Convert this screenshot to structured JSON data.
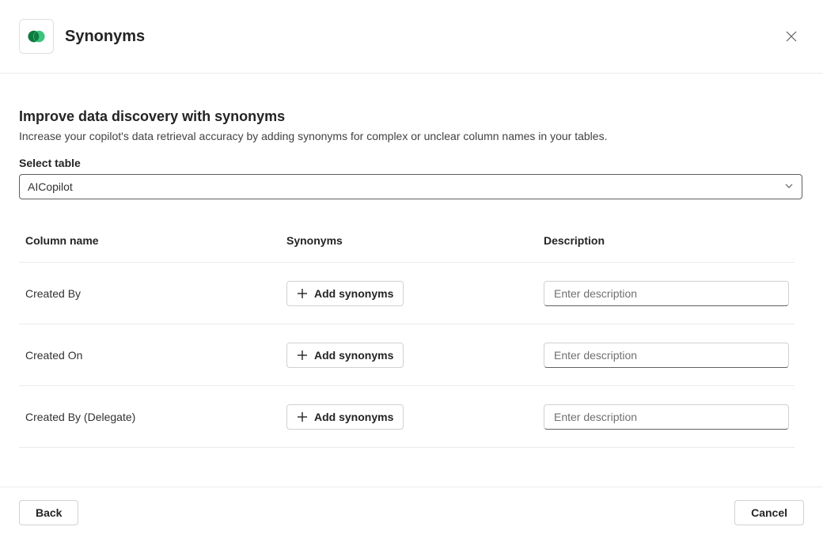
{
  "header": {
    "title": "Synonyms"
  },
  "section": {
    "title": "Improve data discovery with synonyms",
    "subtitle": "Increase your copilot's data retrieval accuracy by adding synonyms for complex or unclear column names in your tables."
  },
  "tableSelect": {
    "label": "Select table",
    "value": "AICopilot"
  },
  "columns": {
    "headers": {
      "name": "Column name",
      "syn": "Synonyms",
      "desc": "Description"
    },
    "addSynLabel": "Add synonyms",
    "descPlaceholder": "Enter description",
    "rows": [
      {
        "name": "Created By"
      },
      {
        "name": "Created On"
      },
      {
        "name": "Created By (Delegate)"
      }
    ]
  },
  "footer": {
    "back": "Back",
    "cancel": "Cancel"
  }
}
